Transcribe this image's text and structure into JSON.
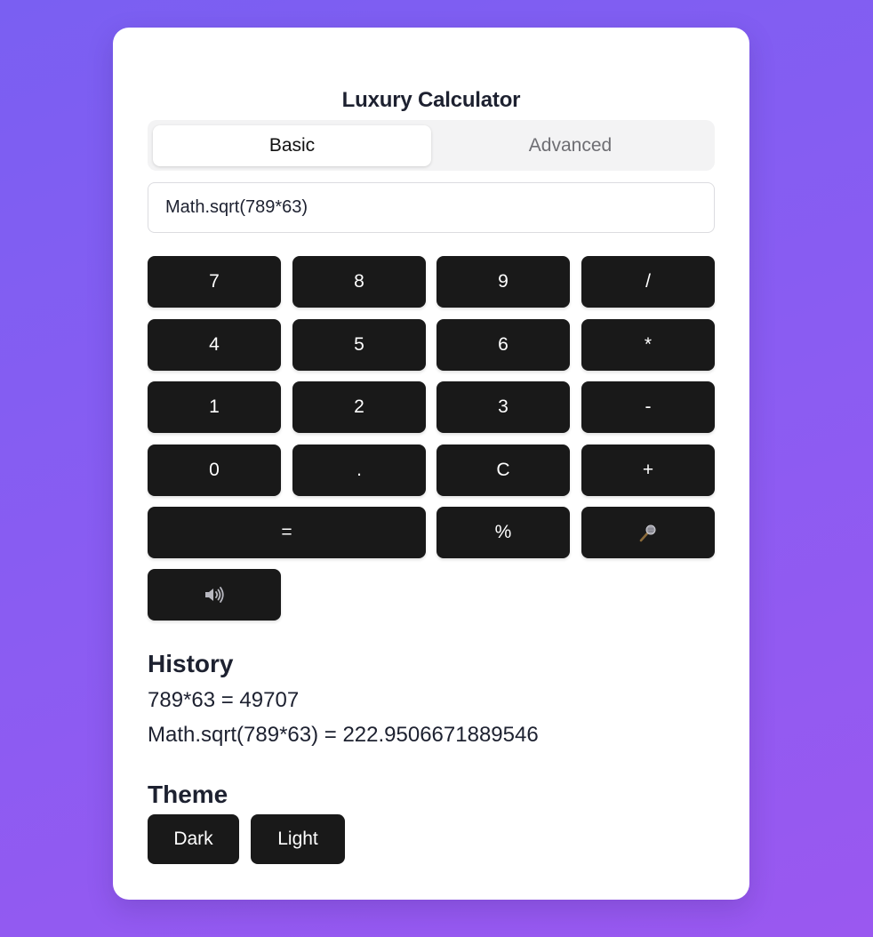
{
  "app": {
    "title": "Luxury Calculator"
  },
  "tabs": [
    {
      "label": "Basic",
      "active": true
    },
    {
      "label": "Advanced",
      "active": false
    }
  ],
  "expression_input": {
    "value": "Math.sqrt(789*63)"
  },
  "keypad": {
    "k7": "7",
    "k8": "8",
    "k9": "9",
    "divide": "/",
    "k4": "4",
    "k5": "5",
    "k6": "6",
    "multiply": "*",
    "k1": "1",
    "k2": "2",
    "k3": "3",
    "minus": "-",
    "k0": "0",
    "dot": ".",
    "clear": "C",
    "plus": "+",
    "equals": "=",
    "percent": "%",
    "mic_icon": "microphone-icon",
    "speaker_icon": "speaker-icon"
  },
  "history": {
    "heading": "History",
    "entries": [
      "789*63 = 49707",
      "Math.sqrt(789*63) = 222.9506671889546"
    ]
  },
  "theme": {
    "heading": "Theme",
    "dark_label": "Dark",
    "light_label": "Light"
  },
  "colors": {
    "background_start": "#7a5ff2",
    "background_end": "#9a58f0",
    "key_background": "#191919",
    "card_background": "#ffffff"
  }
}
